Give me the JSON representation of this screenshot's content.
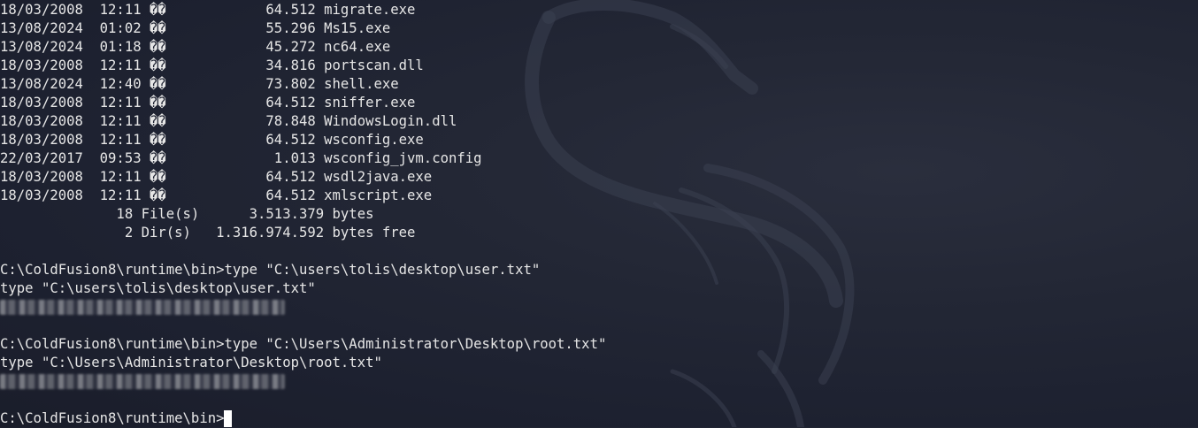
{
  "terminal": {
    "listing": [
      "18/03/2008  12:11 ��            64.512 migrate.exe",
      "13/08/2024  01:02 ��            55.296 Ms15.exe",
      "13/08/2024  01:18 ��            45.272 nc64.exe",
      "18/03/2008  12:11 ��            34.816 portscan.dll",
      "13/08/2024  12:40 ��            73.802 shell.exe",
      "18/03/2008  12:11 ��            64.512 sniffer.exe",
      "18/03/2008  12:11 ��            78.848 WindowsLogin.dll",
      "18/03/2008  12:11 ��            64.512 wsconfig.exe",
      "22/03/2017  09:53 ��             1.013 wsconfig_jvm.config",
      "18/03/2008  12:11 ��            64.512 wsdl2java.exe",
      "18/03/2008  12:11 ��            64.512 xmlscript.exe"
    ],
    "summary_files": "              18 File(s)      3.513.379 bytes",
    "summary_dirs": "               2 Dir(s)   1.316.974.592 bytes free",
    "cmd1_prompt": "C:\\ColdFusion8\\runtime\\bin>type \"C:\\users\\tolis\\desktop\\user.txt\"",
    "cmd1_echo": "type \"C:\\users\\tolis\\desktop\\user.txt\"",
    "cmd2_prompt": "C:\\ColdFusion8\\runtime\\bin>type \"C:\\Users\\Administrator\\Desktop\\root.txt\"",
    "cmd2_echo": "type \"C:\\Users\\Administrator\\Desktop\\root.txt\"",
    "final_prompt": "C:\\ColdFusion8\\runtime\\bin>"
  },
  "theme": {
    "background": "#1d2130",
    "foreground": "#e6e6e6",
    "cursor": "#ffffff"
  }
}
